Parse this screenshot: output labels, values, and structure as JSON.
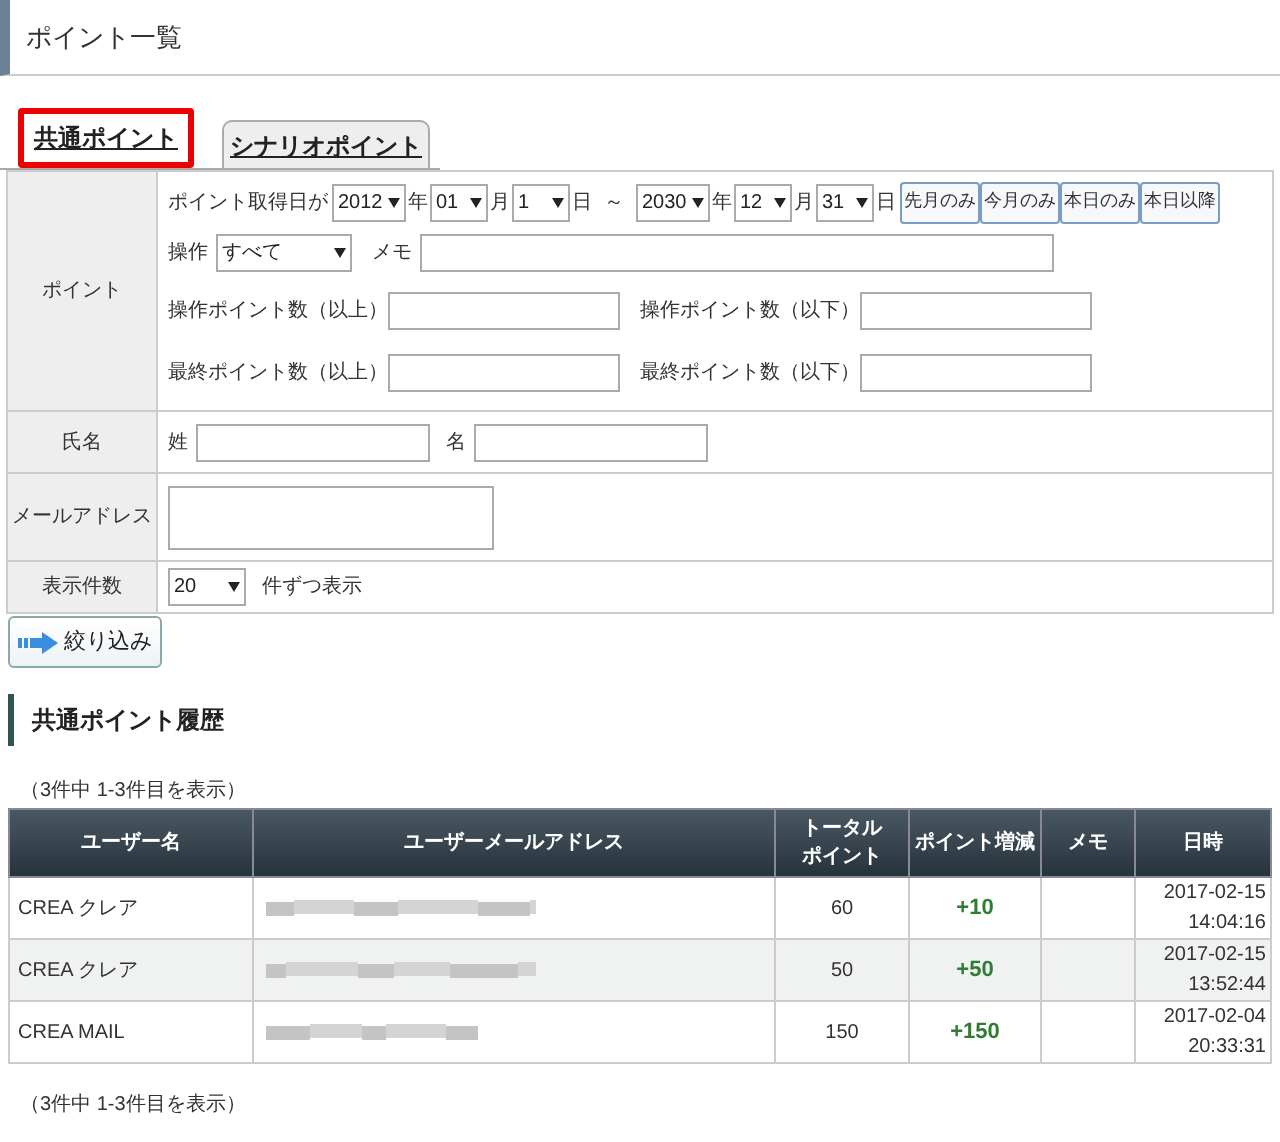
{
  "page_title": "ポイント一覧",
  "tabs": [
    {
      "label": "共通ポイント",
      "selected": true
    },
    {
      "label": "シナリオポイント",
      "selected": false
    }
  ],
  "filter": {
    "point_label": "ポイント",
    "date_label": "ポイント取得日が",
    "from": {
      "year": "2012",
      "year_unit": "年",
      "month": "01",
      "month_unit": "月",
      "day": "1",
      "day_unit": "日"
    },
    "range_sep": "～",
    "to": {
      "year": "2030",
      "year_unit": "年",
      "month": "12",
      "month_unit": "月",
      "day": "31",
      "day_unit": "日"
    },
    "quick_buttons": [
      "先月のみ",
      "今月のみ",
      "本日のみ",
      "本日以降"
    ],
    "operation_label": "操作",
    "operation_value": "すべて",
    "memo_label": "メモ",
    "ranges": [
      {
        "label": "操作ポイント数（以上）"
      },
      {
        "label": "操作ポイント数（以下）"
      },
      {
        "label": "最終ポイント数（以上）"
      },
      {
        "label": "最終ポイント数（以下）"
      }
    ],
    "name_label": "氏名",
    "last_name_label": "姓",
    "first_name_label": "名",
    "email_label": "メールアドレス",
    "per_page_label": "表示件数",
    "per_page_value": "20",
    "per_page_suffix": "件ずつ表示",
    "submit": "絞り込み"
  },
  "history": {
    "title": "共通ポイント履歴",
    "count_top": "（3件中 1-3件目を表示）",
    "columns": [
      {
        "lines": [
          "ユーザー名"
        ]
      },
      {
        "lines": [
          "ユーザーメールアドレス"
        ]
      },
      {
        "lines": [
          "トータル",
          "ポイント"
        ]
      },
      {
        "lines": [
          "ポイント増減"
        ]
      },
      {
        "lines": [
          "メモ"
        ]
      },
      {
        "lines": [
          "日時"
        ]
      }
    ],
    "rows": [
      {
        "name": "CREA クレア",
        "total": "60",
        "delta": "+10",
        "date": "2017-02-15",
        "time": "14:04:16"
      },
      {
        "name": "CREA クレア",
        "total": "50",
        "delta": "+50",
        "date": "2017-02-15",
        "time": "13:52:44"
      },
      {
        "name": "CREA MAIL",
        "total": "150",
        "delta": "+150",
        "date": "2017-02-04",
        "time": "20:33:31"
      }
    ],
    "count_bottom": "（3件中 1-3件目を表示）"
  }
}
